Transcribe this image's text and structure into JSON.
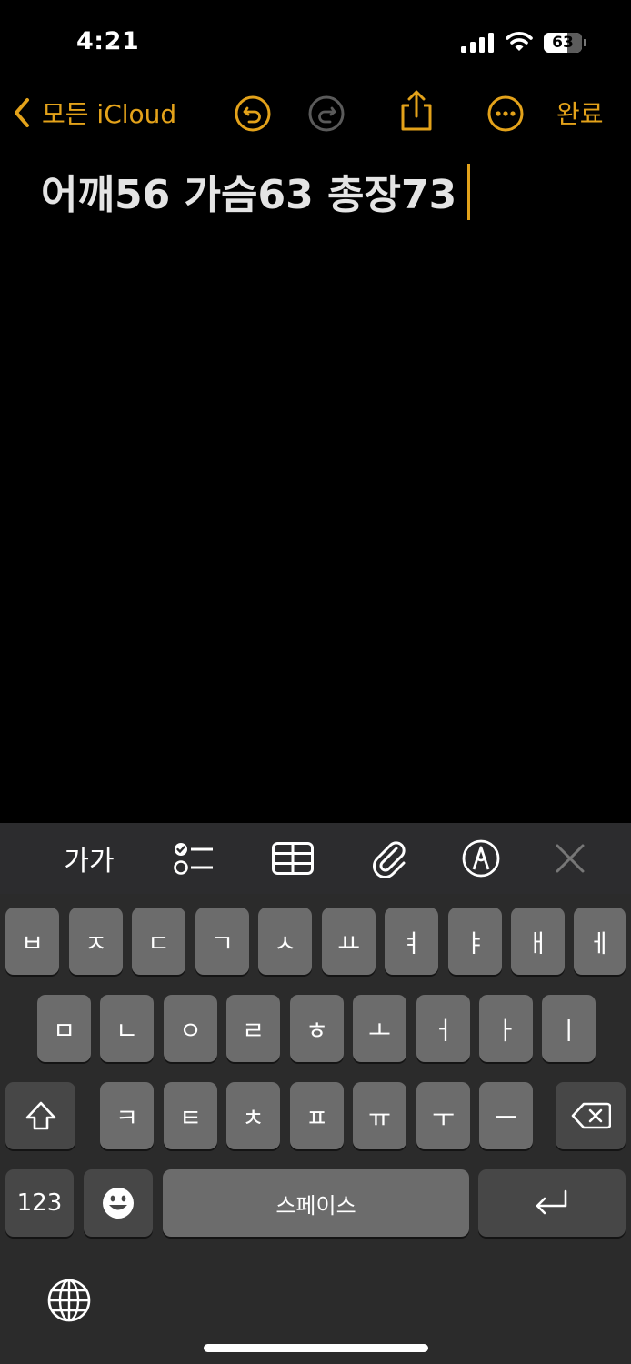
{
  "status_bar": {
    "time": "4:21",
    "battery": "63"
  },
  "nav": {
    "back_label": "모든 iCloud",
    "done_label": "완료",
    "icons": [
      "undo-icon",
      "redo-icon",
      "share-icon",
      "more-icon"
    ]
  },
  "note": {
    "text": "어깨56 가슴63 총장73"
  },
  "format_toolbar": {
    "text_style_label": "가가",
    "icons": [
      "checklist-icon",
      "table-icon",
      "attachment-icon",
      "markup-icon",
      "close-icon"
    ]
  },
  "keyboard": {
    "row1": [
      "ㅂ",
      "ㅈ",
      "ㄷ",
      "ㄱ",
      "ㅅ",
      "ㅛ",
      "ㅕ",
      "ㅑ",
      "ㅐ",
      "ㅔ"
    ],
    "row2": [
      "ㅁ",
      "ㄴ",
      "ㅇ",
      "ㄹ",
      "ㅎ",
      "ㅗ",
      "ㅓ",
      "ㅏ",
      "ㅣ"
    ],
    "row3": [
      "ㅋ",
      "ㅌ",
      "ㅊ",
      "ㅍ",
      "ㅠ",
      "ㅜ",
      "ㅡ"
    ],
    "numbers_label": "123",
    "space_label": "스페이스",
    "icons": [
      "shift-icon",
      "backspace-icon",
      "emoji-icon",
      "return-icon",
      "globe-icon"
    ]
  },
  "colors": {
    "accent": "#e3a21a",
    "background": "#000000",
    "keyboard": "#2b2b2b",
    "key": "#6c6c6c"
  }
}
